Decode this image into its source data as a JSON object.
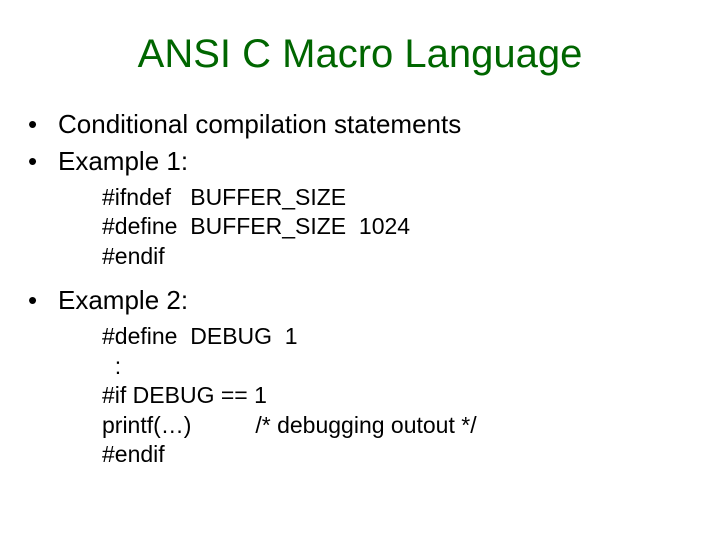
{
  "title": "ANSI C Macro Language",
  "bullets": {
    "b1": "Conditional compilation statements",
    "b2": "Example 1:",
    "b3": "Example 2:"
  },
  "code1": "#ifndef   BUFFER_SIZE\n#define  BUFFER_SIZE  1024\n#endif",
  "code2": "#define  DEBUG  1\n  :\n#if DEBUG == 1\nprintf(…)          /* debugging outout */\n#endif"
}
